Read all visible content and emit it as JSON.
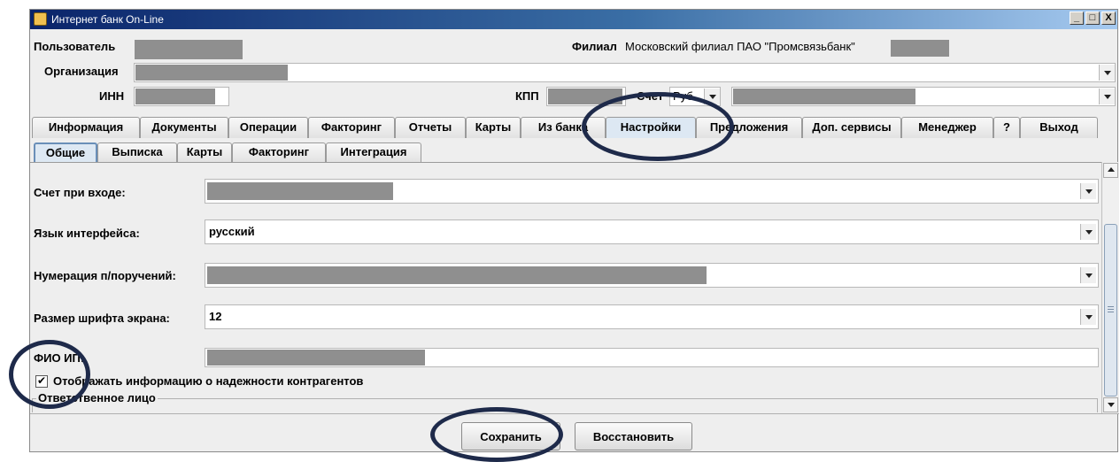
{
  "window": {
    "title": "Интернет банк On-Line",
    "controls": [
      "_",
      "□",
      "X"
    ]
  },
  "header": {
    "user_label": "Пользователь",
    "branch_label": "Филиал",
    "branch_value": "Московский филиал ПАО \"Промсвязьбанк\"",
    "org_label": "Организация",
    "inn_label": "ИНН",
    "kpp_label": "КПП",
    "account_label": "Счет",
    "currency_value": "Руб"
  },
  "main_tabs": [
    "Информация",
    "Документы",
    "Операции",
    "Факторинг",
    "Отчеты",
    "Карты",
    "Из банка",
    "Настройки",
    "Предложения",
    "Доп. сервисы",
    "Менеджер",
    "?",
    "Выход"
  ],
  "sub_tabs": [
    "Общие",
    "Выписка",
    "Карты",
    "Факторинг",
    "Интеграция"
  ],
  "settings": {
    "login_account_label": "Счет при входе:",
    "language_label": "Язык интерфейса:",
    "language_value": "русский",
    "numbering_label": "Нумерация п/поручений:",
    "font_size_label": "Размер шрифта экрана:",
    "font_size_value": "12",
    "fio_label": "ФИО ИП:",
    "reliability_checkbox_label": "Отображать информацию о надежности контрагентов",
    "reliability_checked": true,
    "responsible_group_label": "Ответственное лицо"
  },
  "footer": {
    "save_label": "Сохранить",
    "restore_label": "Восстановить"
  },
  "colors": {
    "annotation": "#1e2a4a",
    "redaction": "#8f8f8f"
  }
}
